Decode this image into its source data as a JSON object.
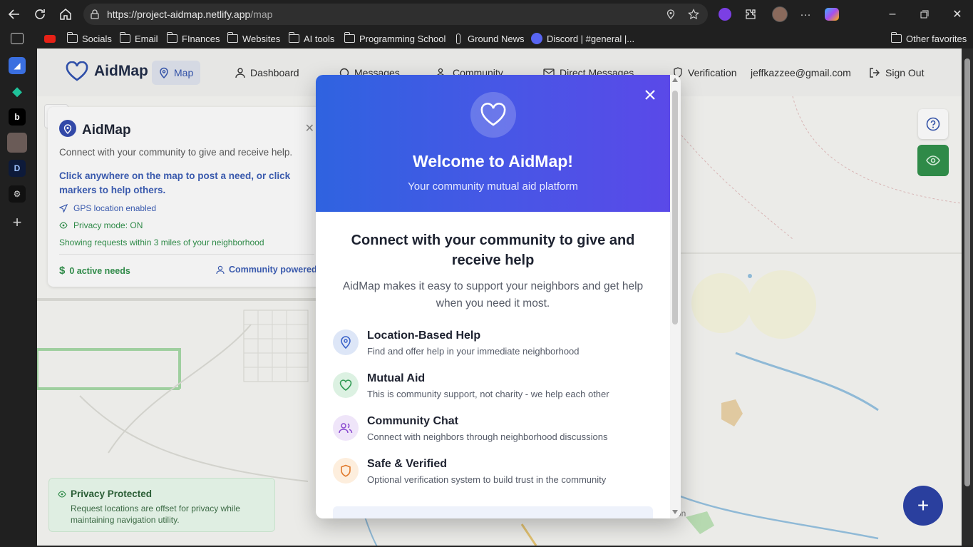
{
  "browser": {
    "url_host": "https://project-aidmap.netlify.app",
    "url_path": "/map",
    "favorites": [
      {
        "label": "Socials"
      },
      {
        "label": "Email"
      },
      {
        "label": "FInances"
      },
      {
        "label": "Websites"
      },
      {
        "label": "AI tools"
      },
      {
        "label": "Programming School"
      },
      {
        "label": "Ground News"
      },
      {
        "label": "Discord | #general |..."
      }
    ],
    "other_favorites": "Other favorites"
  },
  "header": {
    "brand": "AidMap",
    "nav": [
      {
        "label": "Map"
      },
      {
        "label": "Dashboard"
      },
      {
        "label": "Messages"
      },
      {
        "label": "Community"
      },
      {
        "label": "Direct Messages"
      },
      {
        "label": "Verification"
      }
    ],
    "user_email": "jeffkazzee@gmail.com",
    "sign_out": "Sign Out"
  },
  "info_card": {
    "title": "AidMap",
    "description": "Connect with your community to give and receive help.",
    "cta": "Click anywhere on the map to post a need, or click markers to help others.",
    "gps": "GPS location enabled",
    "privacy_mode": "Privacy mode: ON",
    "radius": "Showing requests within 3 miles of your neighborhood",
    "active_needs": "0 active needs",
    "community": "Community powered"
  },
  "privacy_banner": {
    "title": "Privacy Protected",
    "text": "Request locations are offset for privacy while maintaining navigation utility."
  },
  "modal": {
    "title": "Welcome to AidMap!",
    "subtitle": "Your community mutual aid platform",
    "heading": "Connect with your community to give and receive help",
    "intro": "AidMap makes it easy to support your neighbors and get help when you need it most.",
    "features": [
      {
        "title": "Location-Based Help",
        "desc": "Find and offer help in your immediate neighborhood",
        "icon": "map-pin-icon",
        "color": "#3b63c9",
        "bg": "#dde6f7"
      },
      {
        "title": "Mutual Aid",
        "desc": "This is community support, not charity - we help each other",
        "icon": "heart-icon",
        "color": "#2f9a52",
        "bg": "#dcf1e2"
      },
      {
        "title": "Community Chat",
        "desc": "Connect with neighbors through neighborhood discussions",
        "icon": "users-icon",
        "color": "#8a4ad0",
        "bg": "#efe5f9"
      },
      {
        "title": "Safe & Verified",
        "desc": "Optional verification system to build trust in the community",
        "icon": "shield-icon",
        "color": "#e0782a",
        "bg": "#fdeedd"
      }
    ]
  },
  "map_label": "on"
}
